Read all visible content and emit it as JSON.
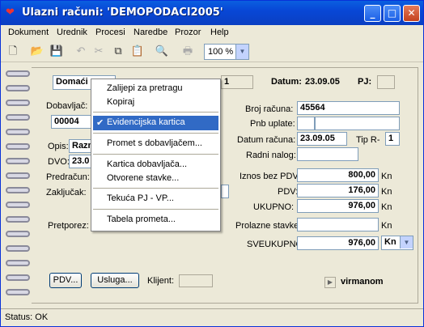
{
  "window": {
    "title": "Ulazni računi: 'DEMOPODACI2005'",
    "min": "_",
    "max": "□",
    "close": "✕"
  },
  "menu": [
    "Dokument",
    "Urednik",
    "Procesi",
    "Naredbe",
    "Prozor",
    "Help"
  ],
  "toolbar": {
    "zoom": "100 %"
  },
  "header": {
    "view_select": "Domaći",
    "num_value": "1",
    "datum_label": "Datum:",
    "datum_value": "23.09.05",
    "pj_label": "PJ:",
    "pj_value": ""
  },
  "left": {
    "dobavljac_label": "Dobavljač:",
    "dobavljac_code": "00004",
    "opis_label": "Opis:",
    "opis_value": "Razn",
    "dvo_label": "DVO:",
    "dvo_value": "23.0",
    "predracun_label": "Predračun:",
    "zakljucak_label": "Zaključak:",
    "pretporez_label": "Pretporez:"
  },
  "right": {
    "broj_label": "Broj računa:",
    "broj_value": "45564",
    "pnb_label": "Pnb uplate:",
    "datum_racuna_label": "Datum računa:",
    "datum_racuna_value": "23.09.05",
    "tip_label": "Tip R-",
    "tip_value": "1",
    "radni_label": "Radni nalog:",
    "iznos_label": "Iznos bez PDV:",
    "iznos_value": "800,00",
    "pdv_label": "PDV:",
    "pdv_value": "176,00",
    "ukupno_label": "UKUPNO:",
    "ukupno_value": "976,00",
    "prolazne_label": "Prolazne stavke:",
    "sveukupno_label": "SVEUKUPNO:",
    "sveukupno_value": "976,00",
    "currency": "Kn",
    "currency_select": "Kn"
  },
  "bottom": {
    "pdv_button": "PDV...",
    "usluga_button": "Usluga...",
    "klijent_label": "Klijent:",
    "virmanom": "virmanom"
  },
  "context_menu": {
    "items": [
      "Zalijepi za pretragu",
      "Kopiraj",
      "Evidencijska kartica",
      "Promet s dobavljačem...",
      "Kartica dobavljača...",
      "Otvorene stavke...",
      "Tekuća PJ - VP...",
      "Tabela prometa..."
    ],
    "checked_index": 2
  },
  "status": "Status: OK"
}
